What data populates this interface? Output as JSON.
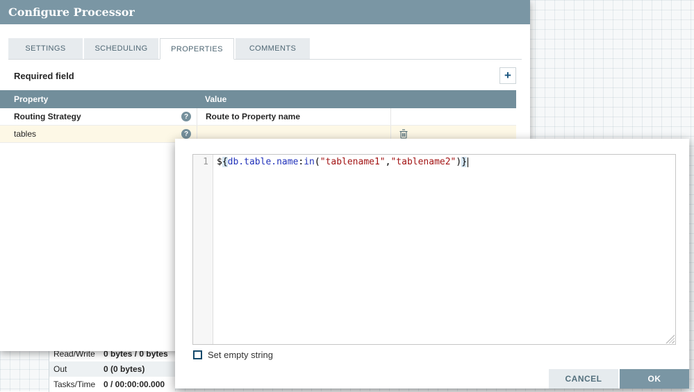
{
  "colors": {
    "accent_slate": "#728e9b",
    "dialog_header_bg": "#7a96a4",
    "row_highlight": "#fdf8e6",
    "string_token": "#a31515",
    "expression_token": "#2233bb"
  },
  "dialog": {
    "title": "Configure Processor",
    "tabs": [
      {
        "label": "SETTINGS"
      },
      {
        "label": "SCHEDULING"
      },
      {
        "label": "PROPERTIES"
      },
      {
        "label": "COMMENTS"
      }
    ],
    "active_tab": "PROPERTIES",
    "required_field_label": "Required field",
    "icons": {
      "add_label": "+",
      "help_label": "?"
    },
    "table": {
      "property_header": "Property",
      "value_header": "Value",
      "rows": [
        {
          "property": "Routing Strategy",
          "value": "Route to Property name"
        },
        {
          "property": "tables",
          "value": ""
        }
      ]
    }
  },
  "value_editor": {
    "line_number": "1",
    "code_segments": [
      {
        "text": "$",
        "type": "plain"
      },
      {
        "text": "{",
        "type": "brace"
      },
      {
        "text": "db.table.name",
        "type": "attribute"
      },
      {
        "text": ":",
        "type": "plain"
      },
      {
        "text": "in",
        "type": "function"
      },
      {
        "text": "(",
        "type": "plain"
      },
      {
        "text": "\"tablename1\"",
        "type": "string"
      },
      {
        "text": ",",
        "type": "plain"
      },
      {
        "text": "\"tablename2\"",
        "type": "string"
      },
      {
        "text": ")",
        "type": "plain"
      },
      {
        "text": "}",
        "type": "brace"
      }
    ],
    "empty_string_label": "Set empty string",
    "buttons": {
      "cancel": "CANCEL",
      "ok": "OK"
    }
  },
  "canvas": {
    "stats": [
      {
        "label": "Read/Write",
        "value": "0 bytes / 0 bytes"
      },
      {
        "label": "Out",
        "value": "0 (0 bytes)"
      },
      {
        "label": "Tasks/Time",
        "value": "0 / 00:00:00.000"
      }
    ]
  }
}
